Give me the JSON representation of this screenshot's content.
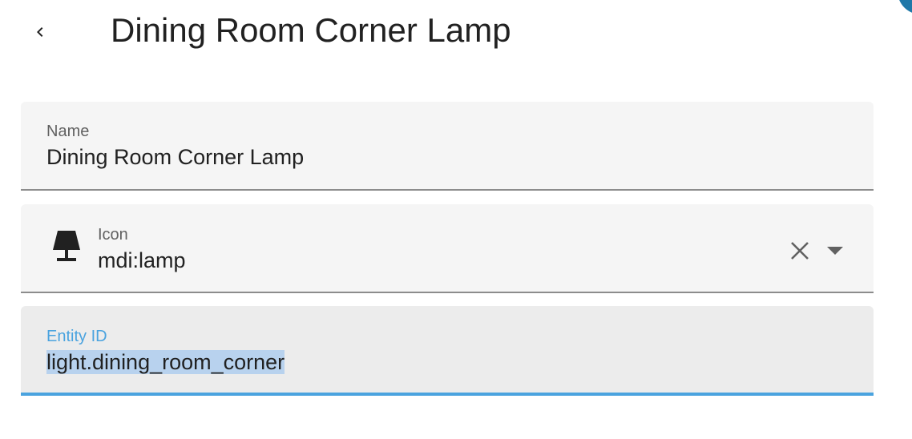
{
  "header": {
    "title": "Dining Room Corner Lamp",
    "back_icon": "chevron-left-icon"
  },
  "fields": {
    "name": {
      "label": "Name",
      "value": "Dining Room Corner Lamp"
    },
    "icon": {
      "label": "Icon",
      "value": "mdi:lamp",
      "leading_icon": "lamp-icon",
      "clear_icon": "close-icon",
      "dropdown_icon": "caret-down-icon"
    },
    "entity_id": {
      "label": "Entity ID",
      "value": "light.dining_room_corner",
      "focused": true,
      "text_selected": true
    }
  },
  "colors": {
    "accent": "#4aa3df",
    "field_background": "#f5f5f5",
    "focused_field_background": "#ececec",
    "selection": "#b8d2ee",
    "text": "#212121",
    "label": "#616161",
    "corner_accent": "#1f78a8"
  }
}
